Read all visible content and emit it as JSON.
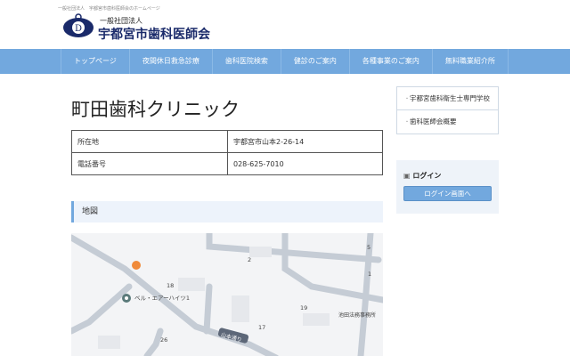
{
  "header": {
    "tagline": "一般社団法人　宇都宮市歯科医師会のホームページ",
    "org_type": "一般社団法人",
    "org_name": "宇都宮市歯科医師会",
    "brand_color": "#1a2a6a"
  },
  "nav": {
    "items": [
      "トップページ",
      "夜間休日救急診療",
      "歯科医院検索",
      "健診のご案内",
      "各種事業のご案内",
      "無料職業紹介所"
    ],
    "color": "#72a8de"
  },
  "main": {
    "title": "町田歯科クリニック",
    "info": [
      {
        "label": "所在地",
        "value": "宇都宮市山本2-26-14"
      },
      {
        "label": "電話番号",
        "value": "028-625-7010"
      }
    ],
    "map_heading": "地図",
    "map_labels": {
      "n2": "2",
      "n18": "18",
      "n19": "19",
      "n17": "17",
      "n26": "26",
      "n1": "1",
      "n5": "5",
      "building": "ベル・エアーハイツ1",
      "office": "池田法務事務所",
      "road": "山本通り"
    }
  },
  "sidebar": {
    "links": [
      "宇都宮歯科衛生士専門学校",
      "歯科医師会概要"
    ],
    "login_title": "ログイン",
    "login_button": "ログイン画面へ"
  }
}
